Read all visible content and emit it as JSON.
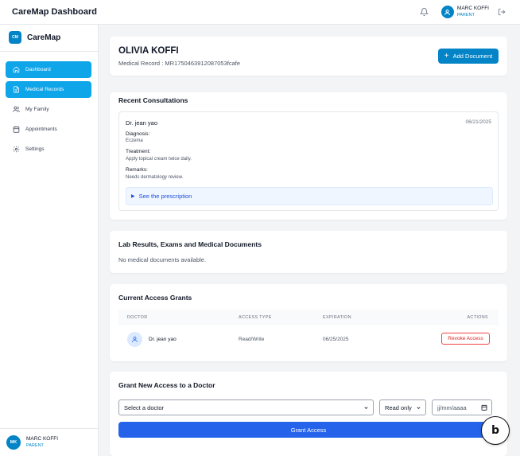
{
  "header": {
    "app_title": "CareMap Dashboard",
    "user_name": "MARC KOFFI",
    "user_role": "PARENT"
  },
  "sidebar": {
    "brand_logo": "CM",
    "brand_name": "CareMap",
    "items": [
      {
        "label": "Dashboard",
        "icon": "home-icon",
        "active": true
      },
      {
        "label": "Medical Records",
        "icon": "document-icon",
        "active": true
      },
      {
        "label": "My Family",
        "icon": "users-icon",
        "active": false
      },
      {
        "label": "Appointments",
        "icon": "calendar-icon",
        "active": false
      },
      {
        "label": "Settings",
        "icon": "gear-icon",
        "active": false
      }
    ],
    "user_initials": "MK",
    "user_name": "MARC KOFFI",
    "user_role": "PARENT"
  },
  "patient": {
    "name": "OLIVIA KOFFI",
    "record_label": "Medical Record : MR1750463912087053fcafe",
    "add_document_label": "Add Document"
  },
  "consultations": {
    "title": "Recent Consultations",
    "items": [
      {
        "doctor": "Dr. jean yao",
        "date": "06/21/2025",
        "diagnosis_label": "Diagnosis:",
        "diagnosis": "Eczema",
        "treatment_label": "Treatment:",
        "treatment": "Apply topical cream twice daily.",
        "remarks_label": "Remarks:",
        "remarks": "Needs dermatology review.",
        "prescription_label": "See the prescription"
      }
    ]
  },
  "lab": {
    "title": "Lab Results, Exams and Medical Documents",
    "empty_message": "No medical documents available."
  },
  "access": {
    "title": "Current Access Grants",
    "columns": [
      "DOCTOR",
      "ACCESS TYPE",
      "EXPIRATION",
      "ACTIONS"
    ],
    "rows": [
      {
        "doctor": "Dr. jean yao",
        "access_type": "Read/Write",
        "expiration": "06/25/2025",
        "action_label": "Revoke Access"
      }
    ]
  },
  "grant": {
    "title": "Grant New Access to a Doctor",
    "doctor_select": "Select a doctor",
    "access_select": "Read only",
    "date_placeholder": "jj/mm/aaaa",
    "button_label": "Grant Access"
  },
  "colors": {
    "primary": "#0284c7",
    "nav_active": "#0ea5e9",
    "grant_button": "#2563eb",
    "danger": "#dc2626"
  }
}
